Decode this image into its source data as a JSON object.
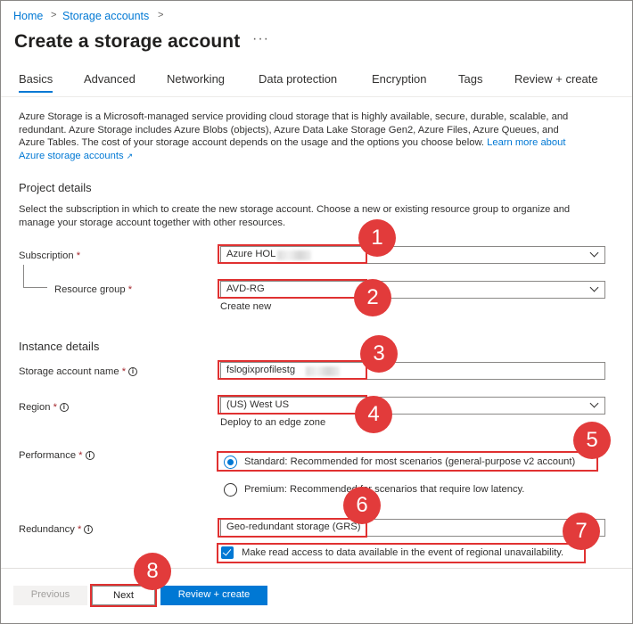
{
  "breadcrumb": {
    "home": "Home",
    "storage_accounts": "Storage accounts",
    "sep": ">"
  },
  "page": {
    "title": "Create a storage account",
    "more": "···"
  },
  "tabs": [
    "Basics",
    "Advanced",
    "Networking",
    "Data protection",
    "Encryption",
    "Tags",
    "Review + create"
  ],
  "intro": {
    "line1": "Azure Storage is a Microsoft-managed service providing cloud storage that is highly available, secure, durable, scalable, and",
    "line2": "redundant. Azure Storage includes Azure Blobs (objects), Azure Data Lake Storage Gen2, Azure Files, Azure Queues, and",
    "line3": "Azure Tables. The cost of your storage account depends on the usage and the options you choose below.",
    "learn_more_a": "Learn more about",
    "learn_more_b": "Azure storage accounts"
  },
  "project": {
    "heading": "Project details",
    "desc1": "Select the subscription in which to create the new storage account. Choose a new or existing resource group to organize and",
    "desc2": "manage your storage account together with other resources.",
    "subscription_label": "Subscription",
    "subscription_value": "Azure HOL",
    "resource_group_label": "Resource group",
    "resource_group_value": "AVD-RG",
    "create_new": "Create new"
  },
  "instance": {
    "heading": "Instance details",
    "name_label": "Storage account name",
    "name_value": "fslogixprofilestg",
    "region_label": "Region",
    "region_value": "(US) West US",
    "edge_zone": "Deploy to an edge zone",
    "performance_label": "Performance",
    "perf_standard": "Standard: Recommended for most scenarios (general-purpose v2 account)",
    "perf_premium": "Premium: Recommended for scenarios that require low latency.",
    "redundancy_label": "Redundancy",
    "redundancy_value": "Geo-redundant storage (GRS)",
    "read_access": "Make read access to data available in the event of regional unavailability."
  },
  "required_mark": "*",
  "info_glyph": "i",
  "footer": {
    "previous": "Previous",
    "next": "Next",
    "review": "Review + create"
  },
  "callouts": [
    "1",
    "2",
    "3",
    "4",
    "5",
    "6",
    "7",
    "8"
  ],
  "colors": {
    "accent": "#0078d4",
    "callout": "#e23b3b",
    "required": "#a4262c"
  }
}
